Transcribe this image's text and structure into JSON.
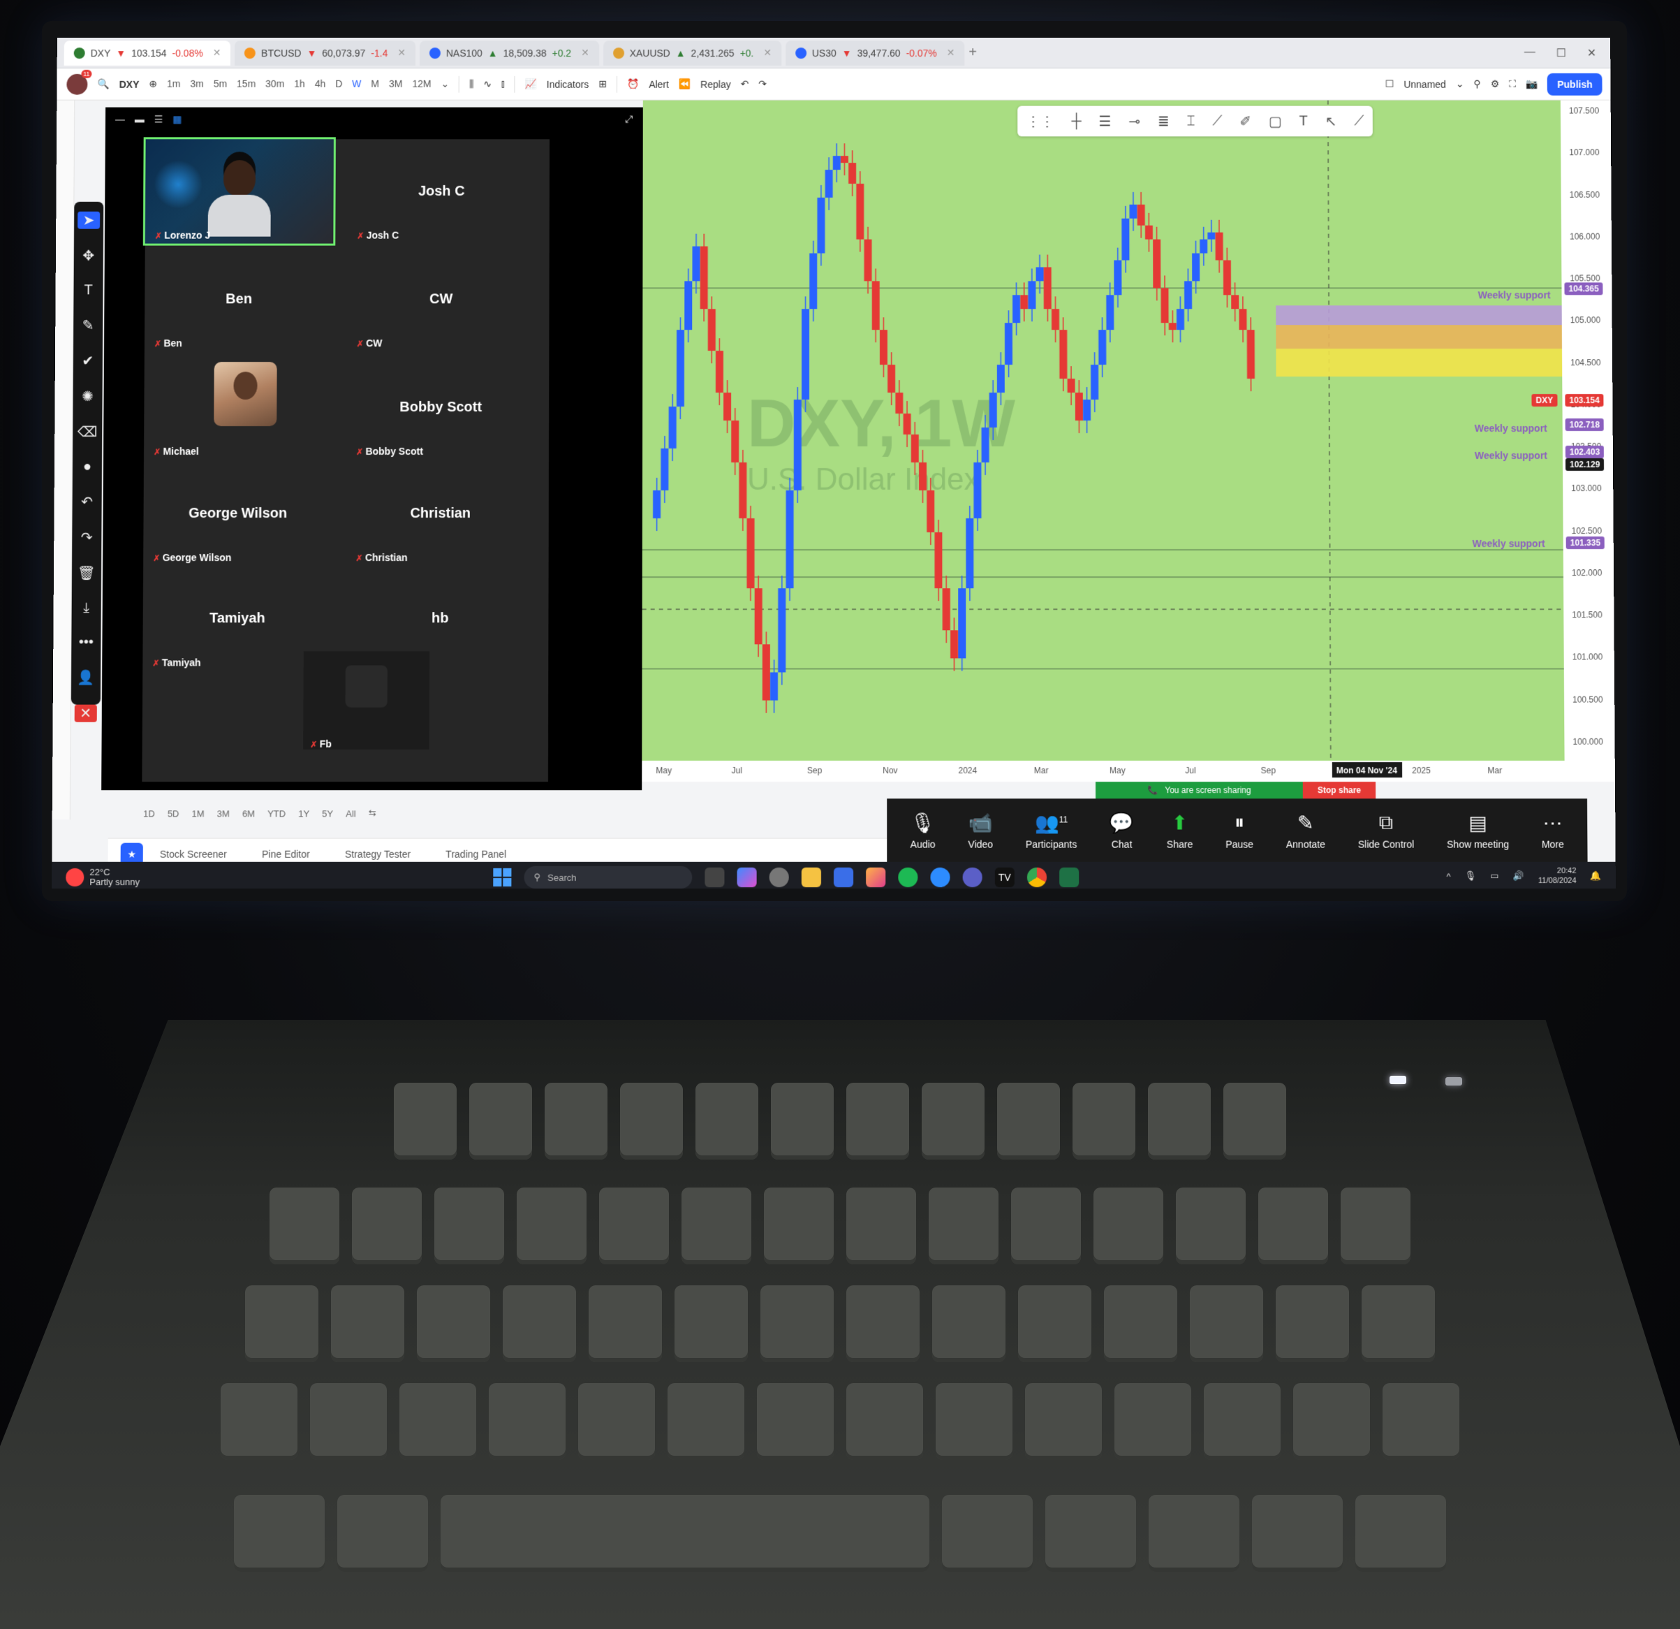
{
  "browser_tabs": [
    {
      "symbol": "DXY",
      "price": "103.154",
      "change": "-0.08%",
      "direction": "down",
      "color": "#2e7d32",
      "active": true
    },
    {
      "symbol": "BTCUSD",
      "price": "60,073.97",
      "change": "-1.4",
      "direction": "down",
      "color": "#f7931a"
    },
    {
      "symbol": "NAS100",
      "price": "18,509.38",
      "change": "+0.2",
      "direction": "up",
      "color": "#2962ff"
    },
    {
      "symbol": "XAUUSD",
      "price": "2,431.265",
      "change": "+0.",
      "direction": "up",
      "color": "#e0a030"
    },
    {
      "symbol": "US30",
      "price": "39,477.60",
      "change": "-0.07%",
      "direction": "down",
      "color": "#2962ff"
    }
  ],
  "toolbar": {
    "symbol": "DXY",
    "intervals": [
      "1m",
      "3m",
      "5m",
      "15m",
      "30m",
      "1h",
      "4h",
      "D",
      "W",
      "M",
      "3M",
      "12M"
    ],
    "selected_interval": "W",
    "indicators_label": "Indicators",
    "alert_label": "Alert",
    "replay_label": "Replay",
    "layout_name": "Unnamed",
    "publish_label": "Publish"
  },
  "zoom_gallery": {
    "participants": [
      {
        "name": "Lorenzo J",
        "display": "",
        "camera": true
      },
      {
        "name": "Josh C",
        "display": "Josh C"
      },
      {
        "name": "Ben",
        "display": "Ben"
      },
      {
        "name": "CW",
        "display": "CW"
      },
      {
        "name": "Michael",
        "display": "",
        "photo": true
      },
      {
        "name": "Bobby Scott",
        "display": "Bobby Scott"
      },
      {
        "name": "George Wilson",
        "display": "George Wilson"
      },
      {
        "name": "Christian",
        "display": "Christian"
      },
      {
        "name": "Tamiyah",
        "display": "Tamiyah"
      },
      {
        "name": "hb",
        "display": "hb"
      },
      {
        "name": "Fb",
        "display": ""
      }
    ]
  },
  "chart": {
    "watermark_title": "DXY, 1W",
    "watermark_subtitle": "U.S. Dollar Index",
    "price_scale": [
      "107.500",
      "107.000",
      "106.500",
      "106.000",
      "105.500",
      "105.000",
      "104.500",
      "104.000",
      "103.500",
      "103.000",
      "102.500",
      "102.000",
      "101.500",
      "101.000",
      "100.500",
      "100.000"
    ],
    "time_axis": [
      "May",
      "Jul",
      "Sep",
      "Nov",
      "2024",
      "Mar",
      "May",
      "Jul",
      "Sep",
      "Mon 04 Nov '24",
      "2025",
      "Mar"
    ],
    "support_levels": [
      {
        "label": "Weekly support",
        "price": "104.365",
        "color": "#8b5fbf"
      },
      {
        "label": "Weekly support",
        "price": "102.718",
        "color": "#8b5fbf"
      },
      {
        "label": "Weekly support",
        "price": "102.403",
        "color": "#8b5fbf"
      },
      {
        "label": "Weekly support",
        "price": "101.335",
        "color": "#8b5fbf"
      }
    ],
    "current_price_label": "DXY",
    "current_price": "103.154",
    "crosshair_price": "102.129",
    "up_color": "#2962ff",
    "down_color": "#e53935",
    "background": "#a9dd82"
  },
  "chart_data": {
    "type": "candlestick",
    "series": [
      {
        "name": "DXY",
        "values": []
      }
    ],
    "ylim": [
      100.0,
      107.5
    ],
    "x_ticks": [
      "May",
      "Jul",
      "Sep",
      "Nov",
      "2024",
      "Mar",
      "May",
      "Jul",
      "Sep",
      "2025",
      "Mar"
    ]
  },
  "period_buttons": [
    "1D",
    "5D",
    "1M",
    "3M",
    "6M",
    "YTD",
    "1Y",
    "5Y",
    "All"
  ],
  "bottom_tabs": [
    "Stock Screener",
    "Pine Editor",
    "Strategy Tester",
    "Trading Panel"
  ],
  "zoom_controls": {
    "sharing_text": "You are screen sharing",
    "stop_share": "Stop share",
    "buttons": [
      {
        "label": "Audio",
        "icon": "microphone-icon"
      },
      {
        "label": "Video",
        "icon": "video-camera-icon"
      },
      {
        "label": "Participants",
        "icon": "participants-icon",
        "count": "11"
      },
      {
        "label": "Chat",
        "icon": "chat-icon"
      },
      {
        "label": "Share",
        "icon": "share-icon"
      },
      {
        "label": "Pause",
        "icon": "pause-icon"
      },
      {
        "label": "Annotate",
        "icon": "pencil-icon"
      },
      {
        "label": "Slide Control",
        "icon": "slide-control-icon"
      },
      {
        "label": "Show meeting",
        "icon": "show-meeting-icon"
      },
      {
        "label": "More",
        "icon": "more-icon"
      }
    ]
  },
  "taskbar": {
    "temperature": "22°C",
    "weather": "Partly sunny",
    "search_placeholder": "Search",
    "time": "20:42",
    "date": "11/08/2024"
  }
}
